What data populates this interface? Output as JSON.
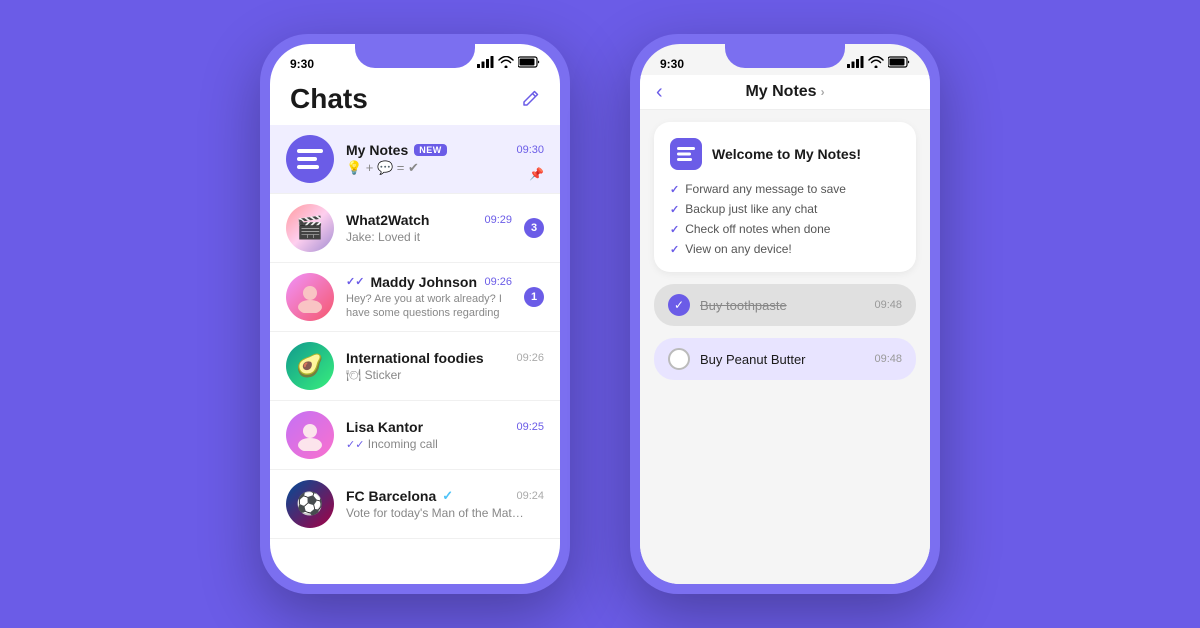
{
  "background_color": "#6B5CE7",
  "phone1": {
    "status_bar": {
      "time": "9:30",
      "signal": "●●●●",
      "wifi": "WiFi",
      "battery": "Battery"
    },
    "header": {
      "title": "Chats",
      "compose_icon": "✏"
    },
    "chats": [
      {
        "id": "my-notes",
        "name": "My Notes",
        "badge": "NEW",
        "time": "09:30",
        "preview": "💡 + 💬 = ✔",
        "avatar_type": "notes",
        "unread": false,
        "pinned": true,
        "active": true
      },
      {
        "id": "what2watch",
        "name": "What2Watch",
        "time": "09:29",
        "preview": "Jake: Loved it",
        "avatar_type": "w2w",
        "avatar_emoji": "🎬",
        "unread": 3,
        "active": false
      },
      {
        "id": "maddy-johnson",
        "name": "Maddy Johnson",
        "time": "09:26",
        "preview": "Hey? Are you at work already? I have some questions regarding",
        "avatar_type": "maddy",
        "avatar_emoji": "👩",
        "unread": 1,
        "double_tick": true,
        "active": false
      },
      {
        "id": "international-foodies",
        "name": "International foodies",
        "time": "09:26",
        "preview": "🍽 Sticker",
        "avatar_type": "intl",
        "avatar_emoji": "🥑",
        "unread": 0,
        "active": false
      },
      {
        "id": "lisa-kantor",
        "name": "Lisa Kantor",
        "time": "09:25",
        "preview": "✓ Incoming call",
        "avatar_type": "lisa",
        "avatar_emoji": "👩‍🦳",
        "unread": 0,
        "double_tick_blue": true,
        "active": false
      },
      {
        "id": "fc-barcelona",
        "name": "FC Barcelona",
        "time": "09:24",
        "preview": "Vote for today's Man of the Match 🏆",
        "avatar_type": "fcb",
        "avatar_emoji": "⚽",
        "unread": 0,
        "verified": true,
        "active": false
      }
    ]
  },
  "phone2": {
    "status_bar": {
      "time": "9:30"
    },
    "nav": {
      "back_label": "‹",
      "title": "My Notes",
      "chevron": "›"
    },
    "welcome_card": {
      "title": "Welcome to My Notes!",
      "items": [
        "Forward any message to save",
        "Backup just like any chat",
        "Check off notes when done",
        "View on any device!"
      ]
    },
    "todos": [
      {
        "text": "Buy toothpaste",
        "time": "09:48",
        "done": true
      },
      {
        "text": "Buy Peanut Butter",
        "time": "09:48",
        "done": false
      }
    ]
  }
}
